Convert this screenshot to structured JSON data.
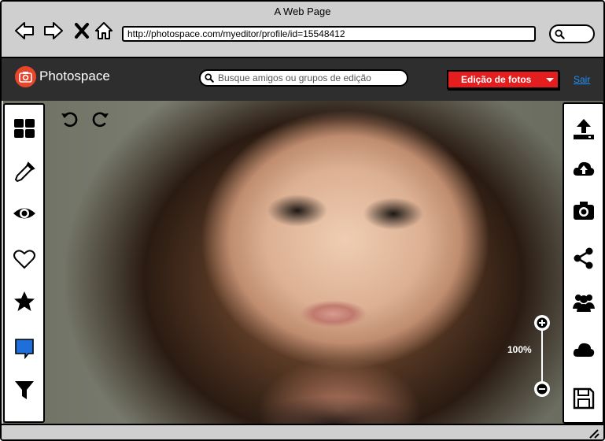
{
  "browser": {
    "title": "A Web Page",
    "url": "http://photospace.com/myeditor/profile/id=15548412"
  },
  "app": {
    "brand": "Photospace",
    "search_placeholder": "Busque amigos ou grupos de edição",
    "dropdown_label": "Edição de fotos",
    "logout_label": "Sair",
    "colors": {
      "accent": "#e41e1e",
      "logo": "#e8452b",
      "header_bg": "#2e2e2e",
      "link": "#1e90ff"
    }
  },
  "editor": {
    "zoom_label": "100%",
    "left_tools": [
      "grid-icon",
      "eyedropper-icon",
      "eye-icon",
      "heart-icon",
      "star-icon",
      "comment-icon",
      "filter-icon"
    ],
    "right_tools": [
      "upload-icon",
      "cloud-upload-icon",
      "camera-icon",
      "share-icon",
      "group-icon",
      "cloud-icon",
      "save-icon"
    ]
  }
}
